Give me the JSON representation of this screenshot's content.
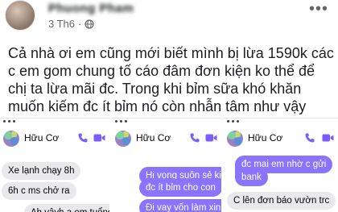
{
  "post": {
    "author": "Phuong Pham",
    "date": "3 Th6",
    "separator": "·",
    "privacy_icon": "globe-icon",
    "more_icon": "more-options-icon",
    "text": "Cả nhà ơi em cũng mới biết mình bị lừa 1590k các c em gom chung tố cáo đâm đơn kiện ko thể để chị ta lừa mãi đc. Trong khi bỉm sữa khó khăn muốn kiếm đc ít bỉm nó còn nhẫn tâm như vậy"
  },
  "chats": [
    {
      "contact": "Hữu Cơ",
      "messages": [
        {
          "side": "in",
          "text": "Xe lạnh chạy 8h"
        },
        {
          "side": "in",
          "text": "6h c ms chở ra"
        },
        {
          "side": "in",
          "text": "Ah vậyh a em tuổng"
        }
      ]
    },
    {
      "contact": "Hữu Cơ",
      "messages": [
        {
          "side": "out",
          "text": "Hi vọng suôn sẻ kiế"
        },
        {
          "side": "out",
          "text": "đc ít bỉm cho con"
        },
        {
          "side": "out",
          "text": "Đi vay vốn làm xin lo"
        }
      ]
    },
    {
      "contact": "Hữu Cơ",
      "messages": [
        {
          "side": "out",
          "text": "đc mai em nhờ c gửi"
        },
        {
          "side": "out",
          "text": "bank"
        },
        {
          "side": "in",
          "text": "C lên đơn báo vườn trc"
        }
      ]
    }
  ],
  "colors": {
    "messenger_accent": "#8a73ff",
    "incoming_bubble": "#e9e9eb",
    "call_icon": "#7b5cff"
  }
}
